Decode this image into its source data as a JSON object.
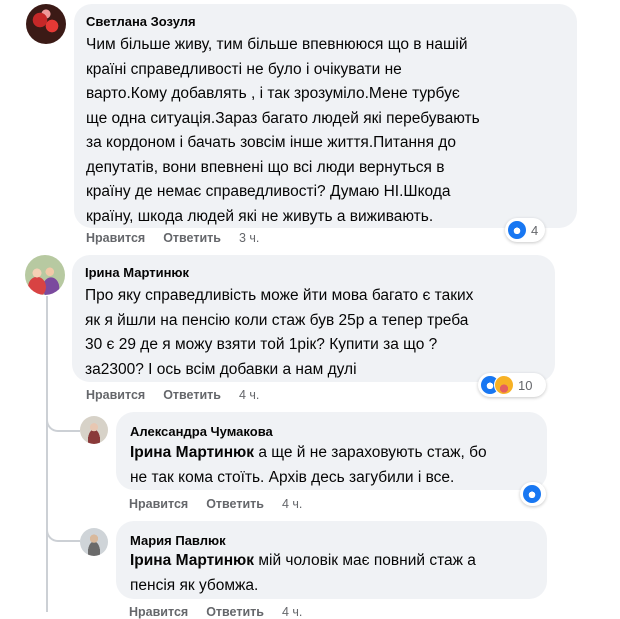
{
  "comments": [
    {
      "author": "Светлана Зозуля",
      "lines": [
        "Чим більше живу, тим більше впевнююся що в нашій",
        "країні справедливості не було і очікувати не",
        "варто.Кому добавлять , і так зрозуміло.Мене турбує",
        "ще одна ситуація.Зараз багато людей які перебувають",
        "за кордоном і бачать зовсім інше життя.Питання до",
        "депутатів, вони впевнені що всі люди вернуться в",
        "країну де немає справедливості? Думаю НІ.Шкода",
        "країну, шкода людей які не живуть а виживають."
      ],
      "like_label": "Нравится",
      "reply_label": "Ответить",
      "time": "3 ч.",
      "reaction_icons": [
        "like-icon"
      ],
      "reaction_count": "4"
    },
    {
      "author": "Ірина Мартинюк",
      "lines": [
        "Про яку справедливість може йти мова багато є таких",
        "як я йшли на пенсію коли стаж був 25р а тепер треба",
        "30 є 29 де я можу взяти той 1рік? Купити за що ?",
        "за2300? І ось всім добавки а нам дулі"
      ],
      "like_label": "Нравится",
      "reply_label": "Ответить",
      "time": "4 ч.",
      "reaction_icons": [
        "like-icon",
        "care-icon"
      ],
      "reaction_count": "10"
    }
  ],
  "replies": [
    {
      "author": "Александра Чумакова",
      "mention": "Ірина Мартинюк",
      "line1_rest": " а ще й не зараховують стаж, бо",
      "line2": "не так кома стоїть. Архів десь загубили і все.",
      "like_label": "Нравится",
      "reply_label": "Ответить",
      "time": "4 ч.",
      "reaction_icons": [
        "like-icon"
      ]
    },
    {
      "author": "Мария Павлюк",
      "mention": "Ірина Мартинюк",
      "line1_rest": " мій чоловік має повний стаж а",
      "line2": "пенсія як убомжа.",
      "like_label": "Нравится",
      "reply_label": "Ответить",
      "time": "4 ч."
    }
  ],
  "colors": {
    "bubble": "#f0f2f5",
    "meta_text": "#65676b",
    "like_blue": "#1877f2",
    "thread_line": "#ccd0d5"
  }
}
